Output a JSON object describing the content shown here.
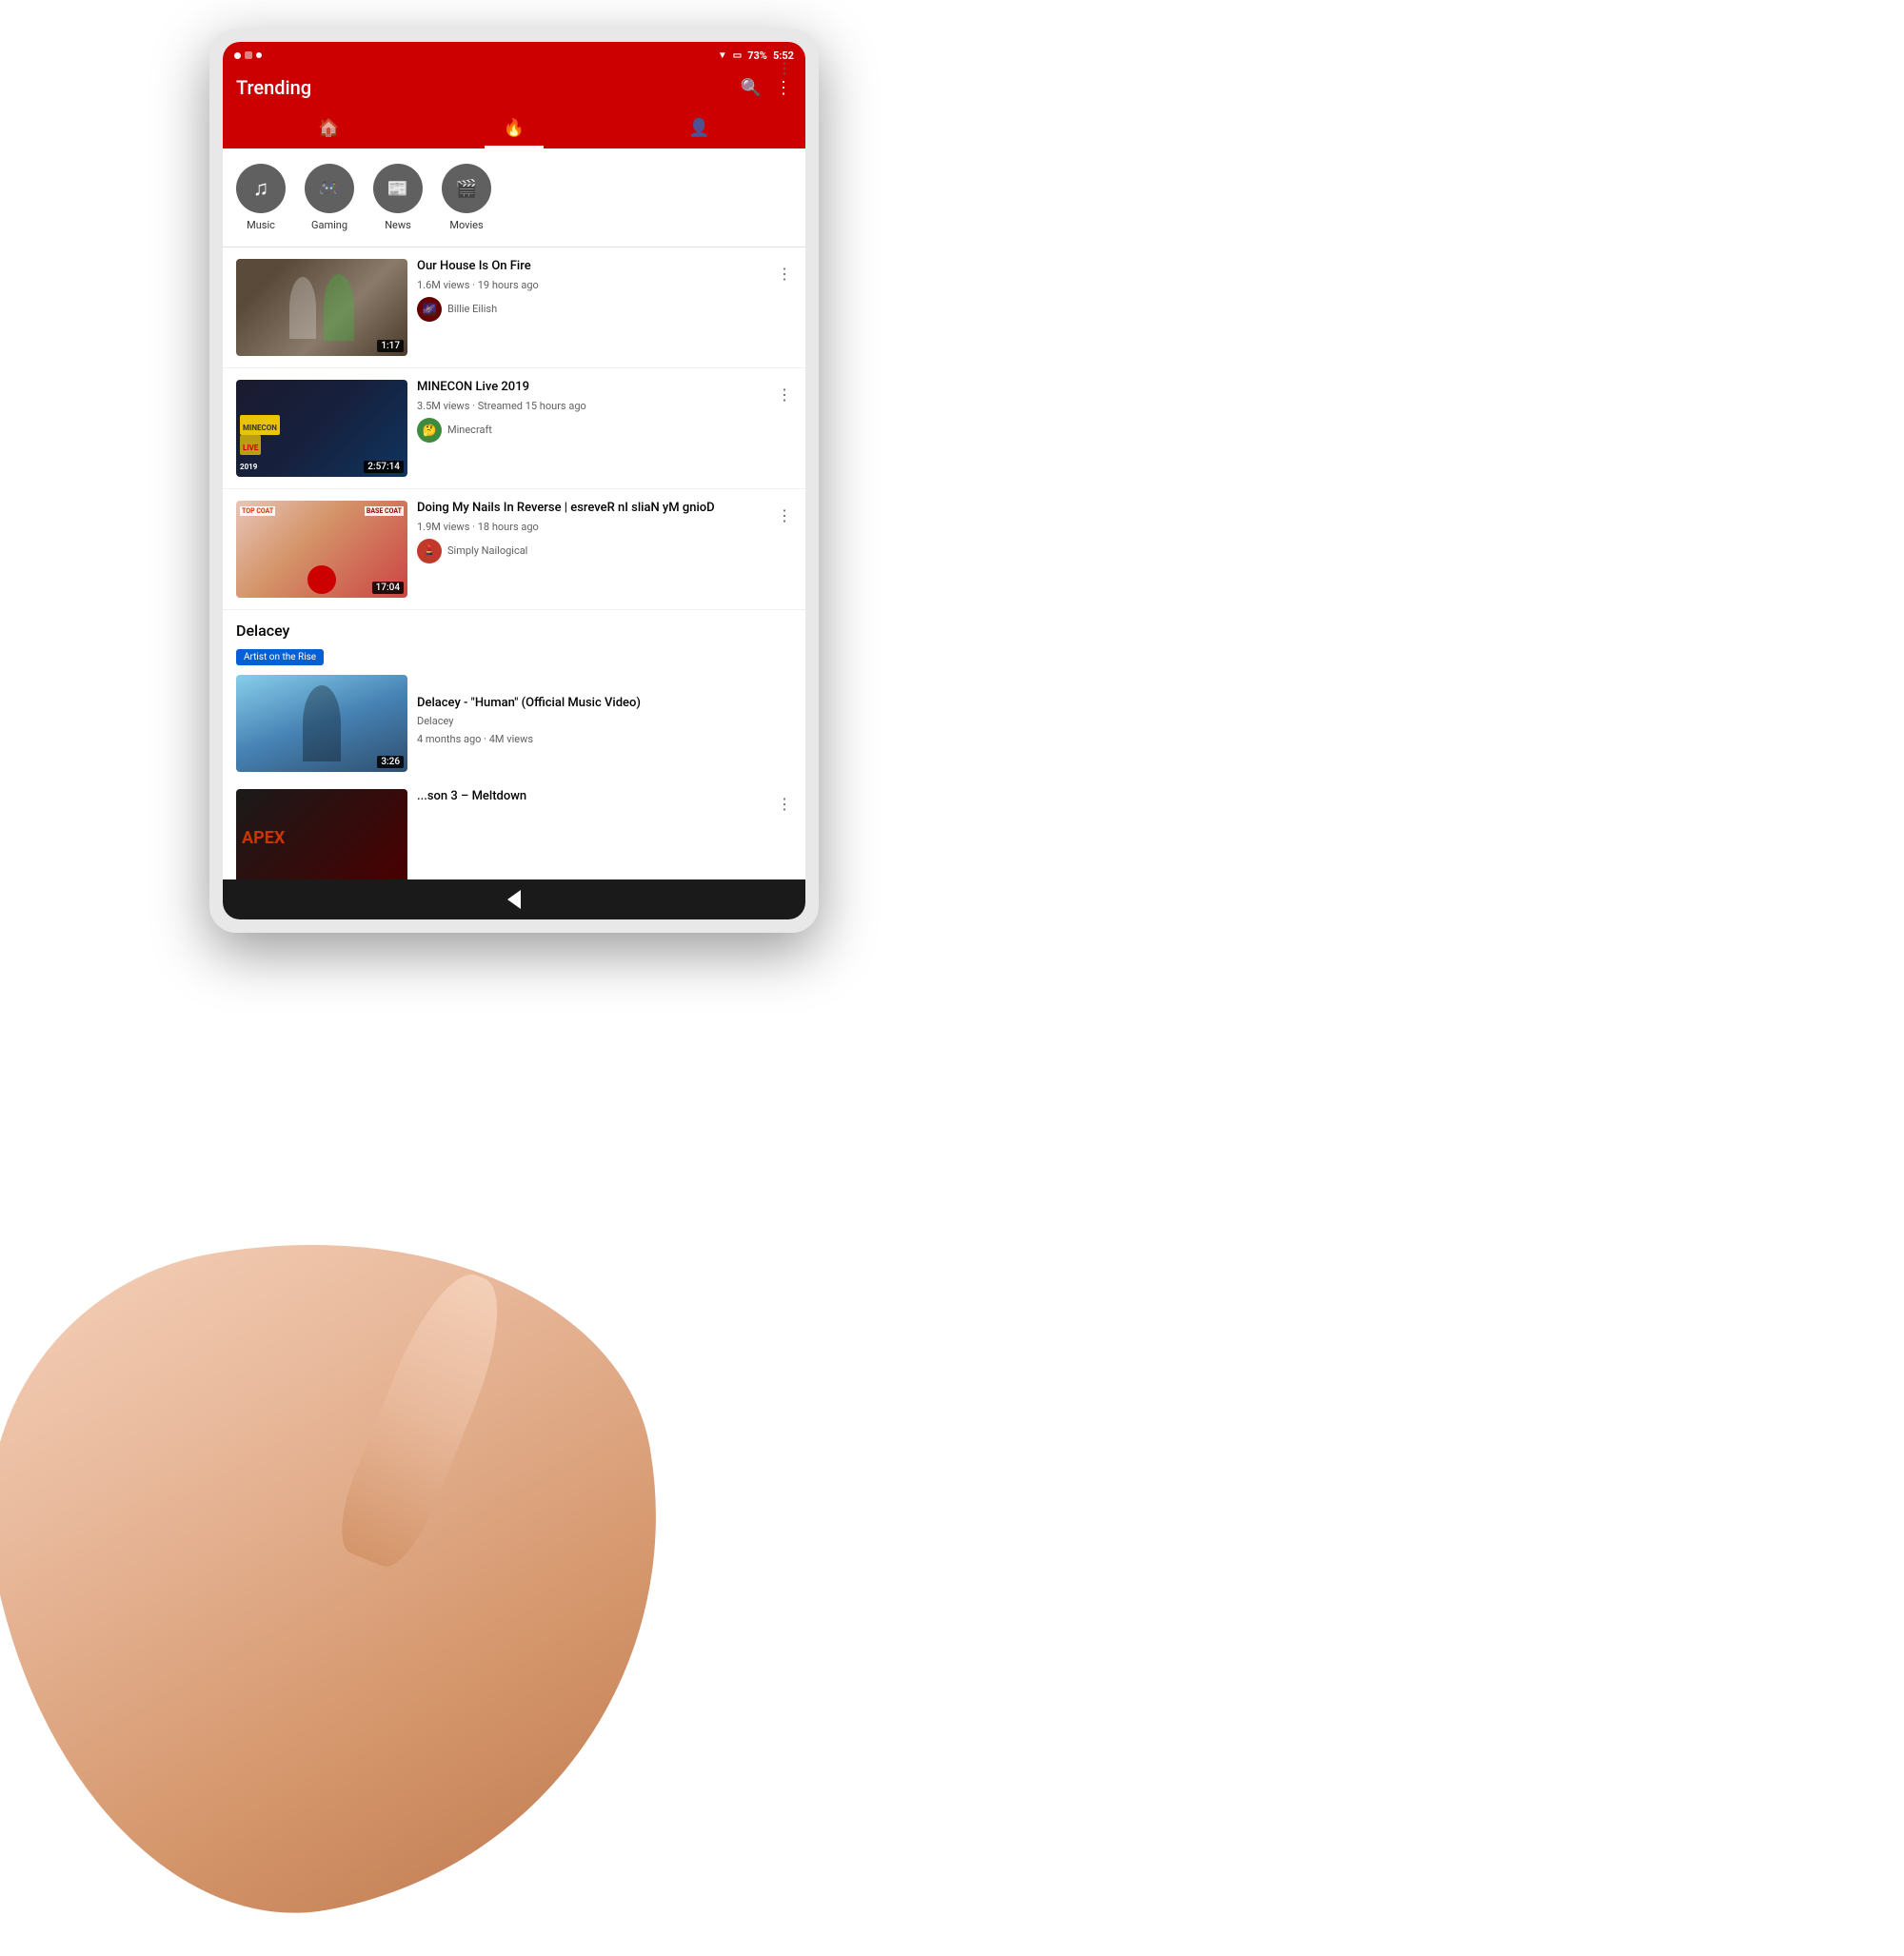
{
  "device": {
    "status_bar": {
      "time": "5:52",
      "battery": "73%",
      "left_icons": [
        "dot1",
        "dot2",
        "dot3"
      ]
    }
  },
  "header": {
    "title": "Trending",
    "search_icon": "🔍",
    "more_icon": "⋮"
  },
  "nav_tabs": [
    {
      "label": "home",
      "icon": "🏠",
      "active": false
    },
    {
      "label": "trending",
      "icon": "🔥",
      "active": true
    },
    {
      "label": "account",
      "icon": "👤",
      "active": false
    }
  ],
  "categories": [
    {
      "id": "music",
      "label": "Music",
      "icon": "♪"
    },
    {
      "id": "gaming",
      "label": "Gaming",
      "icon": "🎮"
    },
    {
      "id": "news",
      "label": "News",
      "icon": "📋"
    },
    {
      "id": "movies",
      "label": "Movies",
      "icon": "🎬"
    }
  ],
  "videos": [
    {
      "id": "v1",
      "title": "Our House Is On Fire",
      "views": "1.6M views",
      "time_ago": "19 hours ago",
      "channel": "Billie Eilish",
      "duration": "1:17"
    },
    {
      "id": "v2",
      "title": "MINECON Live 2019",
      "views": "3.5M views",
      "time_ago": "Streamed 15 hours ago",
      "channel": "Minecraft",
      "duration": "2:57:14"
    },
    {
      "id": "v3",
      "title": "Doing My Nails In Reverse | esreveR nI sliaN yM gnioD",
      "views": "1.9M views",
      "time_ago": "18 hours ago",
      "channel": "Simply Nailogical",
      "duration": "17:04",
      "thumb_text_top": "TOP COAT",
      "thumb_text_mid": "BASE COAT"
    }
  ],
  "artist_section": {
    "name": "Delacey",
    "badge": "Artist on the Rise",
    "video_title": "Delacey - \"Human\" (Official Music Video)",
    "channel": "Delacey",
    "info": "4 months ago · 4M views",
    "duration": "3:26"
  },
  "last_item": {
    "title": "...son 3 – Meltdown",
    "duration": ""
  },
  "bottom_nav": {
    "back_icon": "◁"
  }
}
